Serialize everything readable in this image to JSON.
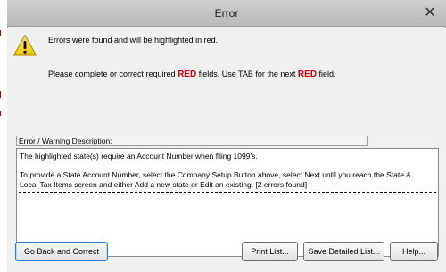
{
  "window": {
    "title": "Error"
  },
  "messages": {
    "line1": "Errors were found and will be highlighted in red.",
    "line2_before": "Please complete or correct required ",
    "line2_red1": "RED",
    "line2_middle": " fields. Use TAB for the next ",
    "line2_red2": "RED",
    "line2_after": " field."
  },
  "description": {
    "label": "Error / Warning Description:",
    "lines": [
      "The highlighted state(s) require an Account Number when filing 1099's.",
      "To provide a State Account Number, select the Company Setup Button above, select Next until you reach the State &",
      "Local Tax Items screen and either Add a new state or Edit an existing. [2 errors found]"
    ]
  },
  "buttons": {
    "back": "Go Back and Correct",
    "print": "Print List...",
    "save": "Save Detailed List...",
    "help": "Help..."
  },
  "colors": {
    "red_text": "#cc0000",
    "focus_border": "#2a7bd4"
  },
  "icons": {
    "warning": "warning-icon",
    "close": "close-icon"
  }
}
